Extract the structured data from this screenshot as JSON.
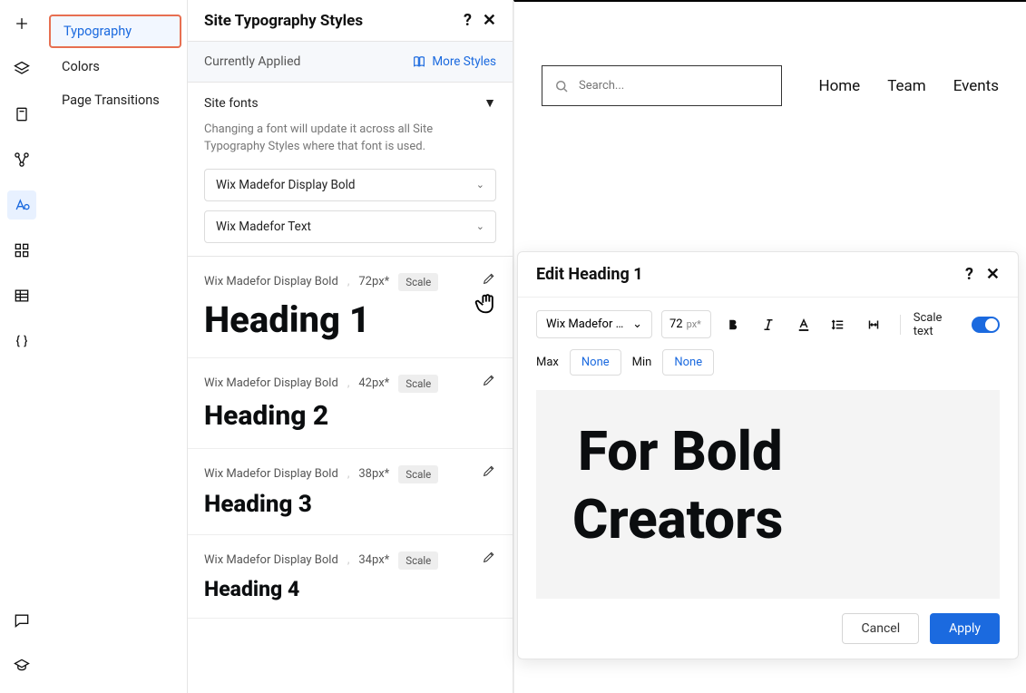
{
  "submenu": {
    "items": [
      "Typography",
      "Colors",
      "Page Transitions"
    ],
    "selected_index": 0
  },
  "typo_panel": {
    "title": "Site Typography Styles",
    "currently_applied_label": "Currently Applied",
    "more_styles_label": "More Styles",
    "site_fonts_label": "Site fonts",
    "site_fonts_desc": "Changing a font will update it across all Site Typography Styles where that font is used.",
    "fonts": [
      "Wix Madefor Display Bold",
      "Wix Madefor Text"
    ],
    "scale_label": "Scale",
    "headings": [
      {
        "font": "Wix Madefor Display Bold",
        "size": "72px*",
        "label": "Heading 1"
      },
      {
        "font": "Wix Madefor Display Bold",
        "size": "42px*",
        "label": "Heading 2"
      },
      {
        "font": "Wix Madefor Display Bold",
        "size": "38px*",
        "label": "Heading 3"
      },
      {
        "font": "Wix Madefor Display Bold",
        "size": "34px*",
        "label": "Heading 4"
      }
    ]
  },
  "site_preview": {
    "search_placeholder": "Search...",
    "nav": [
      "Home",
      "Team",
      "Events"
    ]
  },
  "edit_panel": {
    "title": "Edit Heading 1",
    "font_select": "Wix Madefor Di…",
    "size_value": "72",
    "size_unit": "px*",
    "scale_text_label": "Scale text",
    "max_label": "Max",
    "max_value": "None",
    "min_label": "Min",
    "min_value": "None",
    "preview_text": "For Bold Creators",
    "cancel": "Cancel",
    "apply": "Apply"
  }
}
